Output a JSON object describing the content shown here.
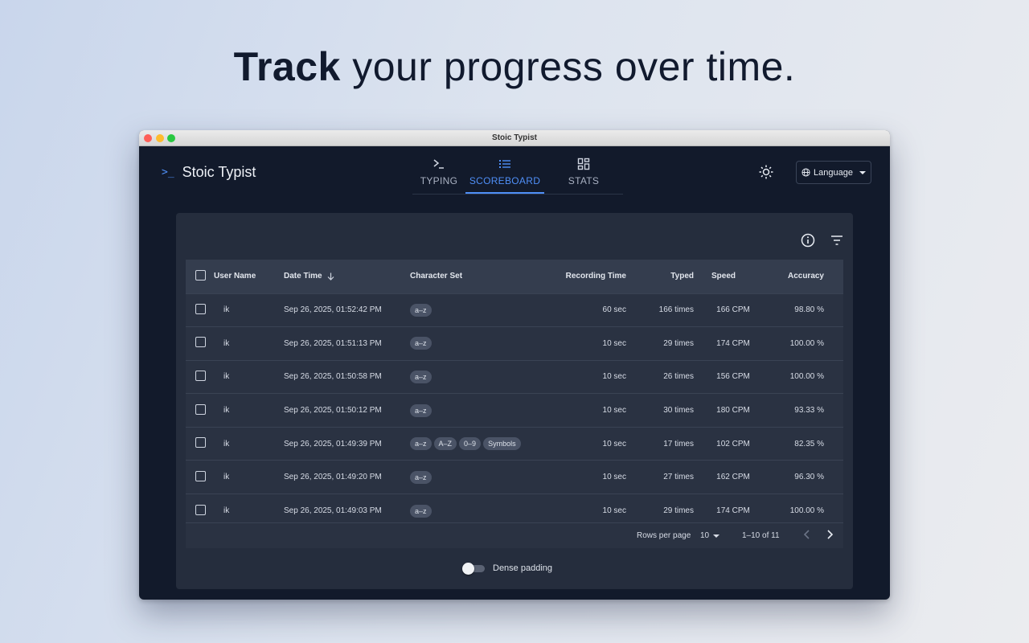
{
  "headline": {
    "bold": "Track",
    "rest": " your progress over time."
  },
  "window": {
    "title": "Stoic Typist"
  },
  "app": {
    "brand_icon": ">_",
    "brand_name": "Stoic Typist",
    "tabs": [
      {
        "label": "TYPING",
        "icon": "terminal-icon"
      },
      {
        "label": "SCOREBOARD",
        "icon": "list-icon",
        "active": true
      },
      {
        "label": "STATS",
        "icon": "grid-icon"
      }
    ],
    "theme_icon": "sun-icon",
    "language_label": "Language"
  },
  "table": {
    "columns": [
      "User Name",
      "Date Time",
      "Character Set",
      "Recording Time",
      "Typed",
      "Speed",
      "Accuracy"
    ],
    "rows": [
      {
        "user": "ik",
        "date": "Sep 26, 2025, 01:52:42 PM",
        "chars": [
          "a–z"
        ],
        "rec": "60 sec",
        "typed": "166 times",
        "speed": "166 CPM",
        "acc": "98.80 %"
      },
      {
        "user": "ik",
        "date": "Sep 26, 2025, 01:51:13 PM",
        "chars": [
          "a–z"
        ],
        "rec": "10 sec",
        "typed": "29 times",
        "speed": "174 CPM",
        "acc": "100.00 %"
      },
      {
        "user": "ik",
        "date": "Sep 26, 2025, 01:50:58 PM",
        "chars": [
          "a–z"
        ],
        "rec": "10 sec",
        "typed": "26 times",
        "speed": "156 CPM",
        "acc": "100.00 %"
      },
      {
        "user": "ik",
        "date": "Sep 26, 2025, 01:50:12 PM",
        "chars": [
          "a–z"
        ],
        "rec": "10 sec",
        "typed": "30 times",
        "speed": "180 CPM",
        "acc": "93.33 %"
      },
      {
        "user": "ik",
        "date": "Sep 26, 2025, 01:49:39 PM",
        "chars": [
          "a–z",
          "A–Z",
          "0–9",
          "Symbols"
        ],
        "rec": "10 sec",
        "typed": "17 times",
        "speed": "102 CPM",
        "acc": "82.35 %"
      },
      {
        "user": "ik",
        "date": "Sep 26, 2025, 01:49:20 PM",
        "chars": [
          "a–z"
        ],
        "rec": "10 sec",
        "typed": "27 times",
        "speed": "162 CPM",
        "acc": "96.30 %"
      },
      {
        "user": "ik",
        "date": "Sep 26, 2025, 01:49:03 PM",
        "chars": [
          "a–z"
        ],
        "rec": "10 sec",
        "typed": "29 times",
        "speed": "174 CPM",
        "acc": "100.00 %"
      }
    ]
  },
  "pagination": {
    "rows_per_page_label": "Rows per page",
    "rows_per_page_value": "10",
    "range": "1–10 of 11"
  },
  "dense_padding_label": "Dense padding",
  "colors": {
    "accent": "#4f8ff7",
    "window_bg": "#121a2b",
    "panel_bg": "#252d3d"
  }
}
